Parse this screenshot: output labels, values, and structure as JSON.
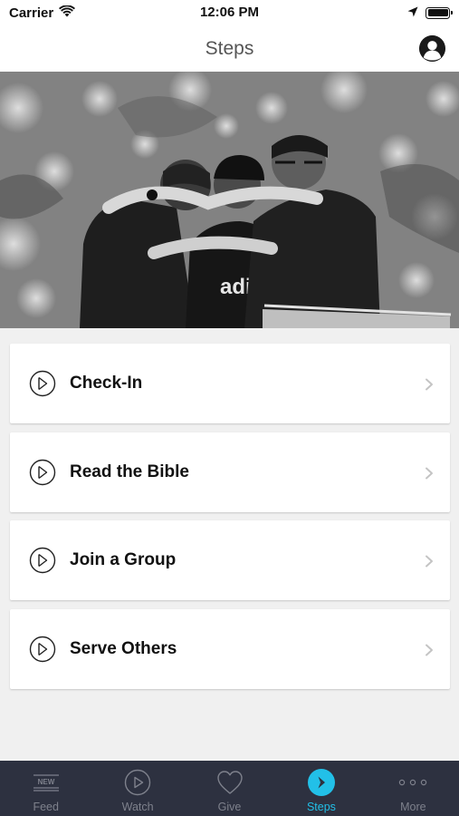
{
  "status_bar": {
    "carrier": "Carrier",
    "time": "12:06 PM"
  },
  "nav": {
    "title": "Steps"
  },
  "hero": {
    "shirt_text": "adidas"
  },
  "steps": [
    {
      "label": "Check-In"
    },
    {
      "label": "Read the Bible"
    },
    {
      "label": "Join a Group"
    },
    {
      "label": "Serve Others"
    }
  ],
  "tab_bar": {
    "feed_badge": "NEW",
    "tabs": [
      {
        "label": "Feed",
        "icon": "feed-icon"
      },
      {
        "label": "Watch",
        "icon": "play-icon"
      },
      {
        "label": "Give",
        "icon": "heart-icon"
      },
      {
        "label": "Steps",
        "icon": "steps-icon",
        "active": true
      },
      {
        "label": "More",
        "icon": "more-dots-icon"
      }
    ]
  },
  "colors": {
    "active_tab": "#22c0e8",
    "tab_bar_bg": "#2d3140",
    "inactive_tab": "#7e818c"
  }
}
